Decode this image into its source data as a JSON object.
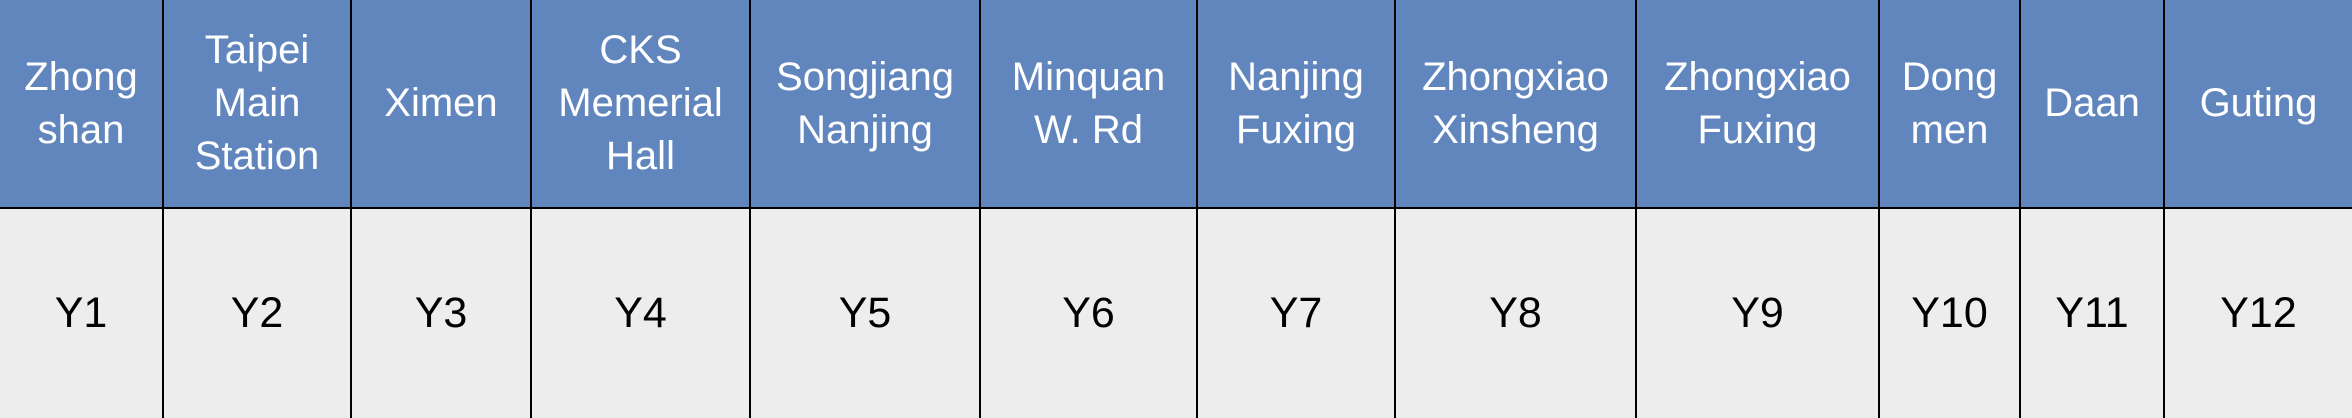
{
  "stations": [
    {
      "name_lines": [
        "Zhong",
        "shan"
      ],
      "code": "Y1"
    },
    {
      "name_lines": [
        "Taipei",
        "Main",
        "Station"
      ],
      "code": "Y2"
    },
    {
      "name_lines": [
        "Ximen"
      ],
      "code": "Y3"
    },
    {
      "name_lines": [
        "CKS",
        "Memerial",
        "Hall"
      ],
      "code": "Y4"
    },
    {
      "name_lines": [
        "Songjiang",
        "Nanjing"
      ],
      "code": "Y5"
    },
    {
      "name_lines": [
        "Minquan",
        "W. Rd"
      ],
      "code": "Y6"
    },
    {
      "name_lines": [
        "Nanjing",
        "Fuxing"
      ],
      "code": "Y7"
    },
    {
      "name_lines": [
        "Zhongxiao",
        "Xinsheng"
      ],
      "code": "Y8"
    },
    {
      "name_lines": [
        "Zhongxiao",
        "Fuxing"
      ],
      "code": "Y9"
    },
    {
      "name_lines": [
        "Dong",
        "men"
      ],
      "code": "Y10"
    },
    {
      "name_lines": [
        "Daan"
      ],
      "code": "Y11"
    },
    {
      "name_lines": [
        "Guting"
      ],
      "code": "Y12"
    }
  ],
  "colors": {
    "header_background": "#6186be",
    "header_text": "#ffffff",
    "body_background": "#ededed",
    "body_text": "#000000",
    "grid_lines": "#000000"
  }
}
